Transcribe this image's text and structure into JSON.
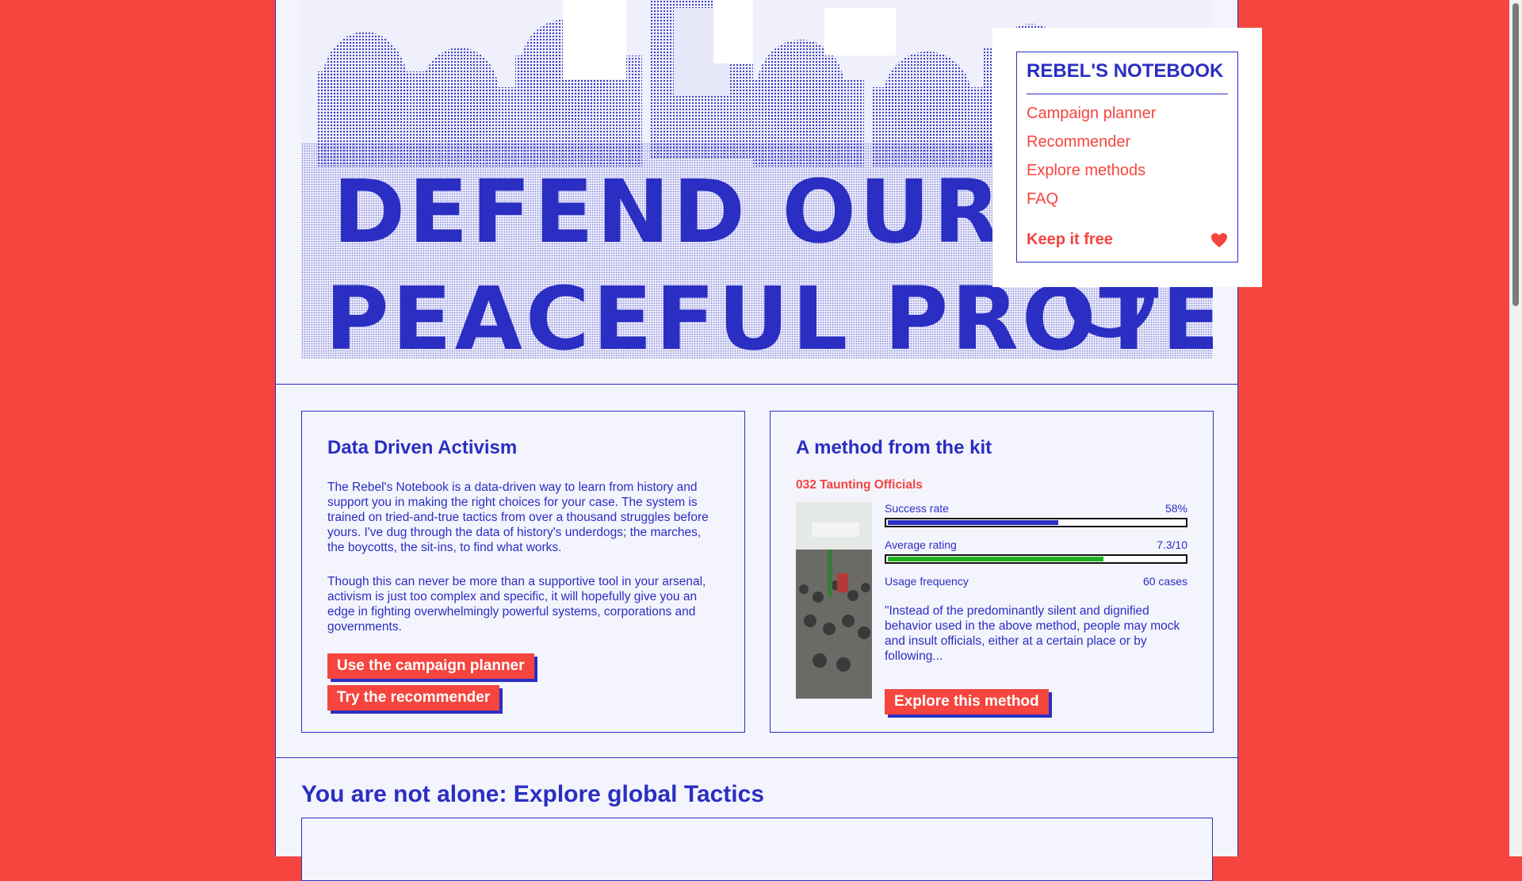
{
  "hero": {
    "banner_line1": "DEFEND OUR RIGHT",
    "banner_line2": "PEACEFUL PROTEST"
  },
  "nav": {
    "title": "REBEL'S NOTEBOOK",
    "items": [
      {
        "label": "Campaign planner"
      },
      {
        "label": "Recommender"
      },
      {
        "label": "Explore methods"
      },
      {
        "label": "FAQ"
      }
    ],
    "donate_label": "Keep it free",
    "donate_icon": "heart-icon"
  },
  "intro": {
    "title": "Data Driven Activism",
    "paragraph1": "The Rebel's Notebook is a data-driven way to learn from history and support you in making the right choices for your case. The system is trained on tried-and-true tactics from over a thousand struggles before yours. I've dug through the data of history's underdogs; the marches, the boycotts, the sit-ins, to find what works.",
    "paragraph2": "Though this can never be more than a supportive tool in your arsenal, activism is just too complex and specific, it will hopefully give you an edge in fighting overwhelmingly powerful systems, corporations and governments.",
    "planner_button": "Use the campaign planner",
    "recommender_button": "Try the recommender"
  },
  "method": {
    "title": "A method from the kit",
    "name": "032 Taunting Officials",
    "success_label": "Success rate",
    "success_value": "58%",
    "success_fraction": 0.58,
    "rating_label": "Average rating",
    "rating_value": "7.3/10",
    "rating_fraction": 0.73,
    "usage_label": "Usage frequency",
    "usage_value": "60 cases",
    "quote": "\"Instead of the predominantly silent and dignified behavior used in the above method, people may mock and insult officials, either at a certain place or by following...",
    "explore_button": "Explore this method"
  },
  "global": {
    "title": "You are not alone: Explore global Tactics"
  },
  "colors": {
    "brand_red": "#f5453e",
    "brand_blue": "#2b2ec2",
    "success_bar": "#2b2ec2",
    "rating_bar": "#1fb21f"
  }
}
